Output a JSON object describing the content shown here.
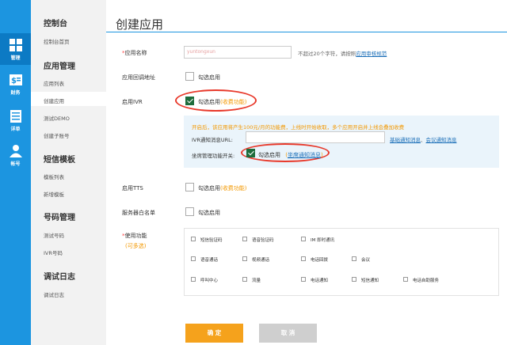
{
  "rail": [
    {
      "label": "管理",
      "icon": "grid-icon",
      "active": true
    },
    {
      "label": "财务",
      "icon": "money-icon",
      "active": false
    },
    {
      "label": "详单",
      "icon": "list-icon",
      "active": false
    },
    {
      "label": "帐号",
      "icon": "user-icon",
      "active": false
    }
  ],
  "nav": {
    "console": {
      "title": "控制台",
      "items": [
        "控制台首页"
      ]
    },
    "apps": {
      "title": "应用管理",
      "items": [
        "应用列表",
        "创建应用",
        "测试DEMO",
        "创建子账号"
      ]
    },
    "sms": {
      "title": "短信模板",
      "items": [
        "模板列表",
        "新增模板"
      ]
    },
    "numbers": {
      "title": "号码管理",
      "items": [
        "测试号码",
        "IVR号码"
      ]
    },
    "logs": {
      "title": "调试日志",
      "items": [
        "调试日志"
      ]
    }
  },
  "page": {
    "title": "创建应用"
  },
  "form": {
    "app_name": {
      "required_mark": "*",
      "label": "应用名称",
      "value": "yuntongxun",
      "hint": "不超过20个字符，请按照",
      "hint_link": "应用审核规范"
    },
    "callback": {
      "label": "应用回调地址",
      "check": "勾选启用"
    },
    "ivr": {
      "label": "启用IVR",
      "check": "勾选启用",
      "paid": "(收费功能)",
      "checked": true
    },
    "ivr_panel": {
      "notice": "开启后，该应用将产生100元/月的功能费，上线时开始收取，多个应用开启并上线会叠加收费",
      "url_label": "IVR通知消息URL:",
      "url_link1": "基础通知消息",
      "url_sep": "、",
      "url_link2": "会议通知消息",
      "seat_label": "坐席管理功能开关:",
      "seat_check": "勾选启用",
      "seat_link_pre": "(",
      "seat_link": "坐席通知消息",
      "seat_link_post": ")"
    },
    "tts": {
      "label": "启用TTS",
      "check": "勾选启用",
      "paid": "(收费功能)"
    },
    "whitelist": {
      "label": "服务器白名单",
      "check": "勾选启用"
    },
    "features": {
      "required_mark": "*",
      "label": "使用功能",
      "multi": "(可多选)",
      "items": [
        "短信验证码",
        "语音验证码",
        "IM 即时通讯",
        "语音通话",
        "视频通话",
        "电话回拨",
        "会议",
        "呼叫中心",
        "流量",
        "电话通知",
        "短信通知",
        "电话自助服务"
      ]
    }
  },
  "buttons": {
    "confirm": "确 定",
    "cancel": "取 消"
  },
  "colors": {
    "rail": "#1c95e0",
    "accent_orange": "#f39800",
    "check_green": "#1e6c3c",
    "ring_red": "#e8392b"
  }
}
